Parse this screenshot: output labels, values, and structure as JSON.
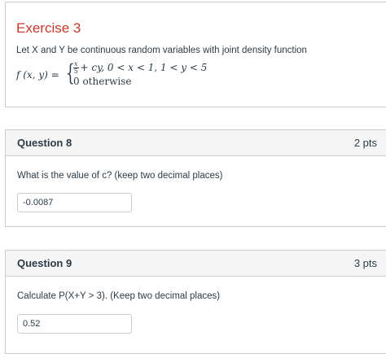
{
  "exercise": {
    "title": "Exercise 3",
    "intro": "Let X and Y be continuous random variables with joint density function",
    "formula": {
      "lhs_name": "f",
      "lhs_args": " (x, y) = ",
      "frac_num": "x",
      "frac_den": "5",
      "case1_rest": "+ cy, 0 < x < 1, 1 < y < 5",
      "case2": "0 otherwise"
    }
  },
  "questions": [
    {
      "title": "Question 8",
      "points": "2 pts",
      "text": "What is the value of c? (keep two decimal places)",
      "answer": "-0.0087"
    },
    {
      "title": "Question 9",
      "points": "3 pts",
      "text": "Calculate P(X+Y > 3). (Keep two decimal places)",
      "answer": "0.52"
    }
  ]
}
